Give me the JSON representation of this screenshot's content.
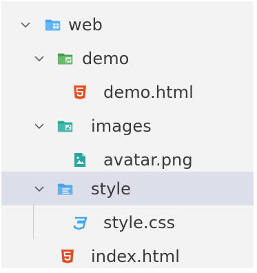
{
  "tree": {
    "items": [
      {
        "label": "web",
        "type": "folder",
        "expanded": true,
        "icon": "web-folder-icon",
        "selected": false
      },
      {
        "label": "demo",
        "type": "folder",
        "expanded": true,
        "icon": "demo-folder-icon",
        "selected": false
      },
      {
        "label": "demo.html",
        "type": "file",
        "icon": "html5-icon",
        "selected": false
      },
      {
        "label": "images",
        "type": "folder",
        "expanded": true,
        "icon": "images-folder-icon",
        "selected": false
      },
      {
        "label": "avatar.png",
        "type": "file",
        "icon": "image-file-icon",
        "selected": false
      },
      {
        "label": "style",
        "type": "folder",
        "expanded": true,
        "icon": "style-folder-icon",
        "selected": true
      },
      {
        "label": "style.css",
        "type": "file",
        "icon": "css3-icon",
        "selected": false
      },
      {
        "label": "index.html",
        "type": "file",
        "icon": "html5-icon",
        "selected": false
      }
    ]
  },
  "colors": {
    "panel_background": "#f3f3f3",
    "selected_row": "#e4e6f1",
    "text": "#3a3a3a",
    "chevron": "#5f5f5f",
    "web_folder": "#42a5f5",
    "demo_folder": "#43a047",
    "images_folder": "#26a69a",
    "style_folder": "#42a5f5",
    "html_file": "#e44d26",
    "css_file": "#42a5f5",
    "image_file": "#26a69a"
  }
}
